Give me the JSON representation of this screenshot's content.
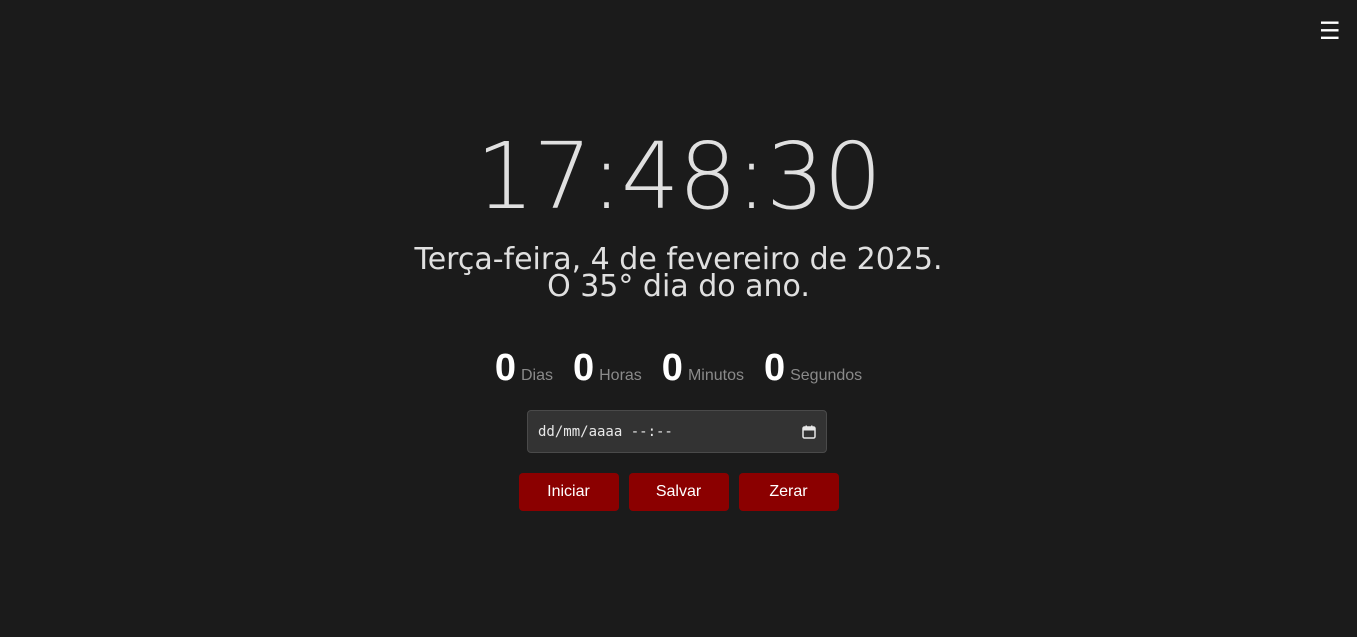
{
  "menu": {
    "icon": "hamburger-menu-icon",
    "glyph": "☰"
  },
  "clock": {
    "time": "17:48:30"
  },
  "date": {
    "line1": "Terça-feira, 4 de fevereiro de 2025.",
    "line2": "O 35° dia do ano."
  },
  "countdown": {
    "days": {
      "value": "0",
      "label": "Dias"
    },
    "hours": {
      "value": "0",
      "label": "Horas"
    },
    "minutes": {
      "value": "0",
      "label": "Minutos"
    },
    "seconds": {
      "value": "0",
      "label": "Segundos"
    }
  },
  "datetime_input": {
    "placeholder": "dd/mm/aaaa --:--",
    "icon": "calendar-icon"
  },
  "buttons": {
    "start": "Iniciar",
    "save": "Salvar",
    "reset": "Zerar"
  },
  "colors": {
    "background": "#1b1b1b",
    "button": "#8b0000",
    "text": "#e0e0e0",
    "label": "#8a8a8a"
  }
}
